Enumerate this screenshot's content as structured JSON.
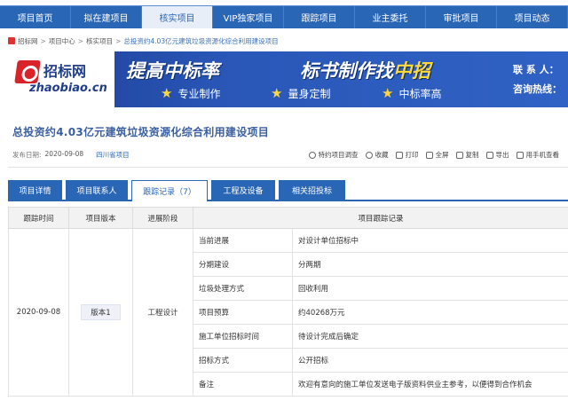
{
  "nav": {
    "items": [
      "项目首页",
      "拟在建项目",
      "核实项目",
      "VIP独家项目",
      "跟踪项目",
      "业主委托",
      "审批项目",
      "项目动态"
    ],
    "active_index": 2
  },
  "breadcrumb": {
    "items": [
      "招标网",
      "项目中心",
      "核实项目",
      "总投资约4.03亿元建筑垃圾资源化综合利用建设项目"
    ],
    "separator": ">"
  },
  "banner": {
    "logo_cn": "招标网",
    "logo_en": "zhaobiao.cn",
    "slogan_1": "提高中标率",
    "slogan_2_main": "标书制作找",
    "slogan_2_highlight": "中招",
    "features": [
      "专业制作",
      "量身定制",
      "中标率高"
    ],
    "contact_label": "联 系 人：",
    "hotline_label": "咨询热线："
  },
  "project": {
    "title": "总投资约4.03亿元建筑垃圾资源化综合利用建设项目",
    "publish_label": "发布日期:",
    "publish_date": "2020-09-08",
    "region": "四川省项目"
  },
  "tools": [
    "特约项目调查",
    "收藏",
    "打印",
    "全屏",
    "复制",
    "导出",
    "用手机查看"
  ],
  "tabs": [
    "项目详情",
    "项目联系人",
    "跟踪记录（7）",
    "工程及设备",
    "相关招投标"
  ],
  "active_tab": 2,
  "record_table": {
    "headers": [
      "跟踪时间",
      "项目版本",
      "进展阶段",
      "项目跟踪记录"
    ],
    "date": "2020-09-08",
    "version": "版本1",
    "stage": "工程设计",
    "rows": [
      {
        "label": "当前进展",
        "value": "对设计单位招标中"
      },
      {
        "label": "分期建设",
        "value": "分两期"
      },
      {
        "label": "垃圾处理方式",
        "value": "回收利用"
      },
      {
        "label": "项目预算",
        "value": "约40268万元"
      },
      {
        "label": "施工单位招标时间",
        "value": "待设计完成后确定"
      },
      {
        "label": "招标方式",
        "value": "公开招标"
      },
      {
        "label": "备注",
        "value": "欢迎有意向的施工单位发送电子版资料供业主参考，以便得到合作机会"
      }
    ]
  },
  "colors": {
    "nav_bg": "#2a66b6",
    "title_blue": "#3a5fa0",
    "banner_yellow": "#ffd93b"
  }
}
